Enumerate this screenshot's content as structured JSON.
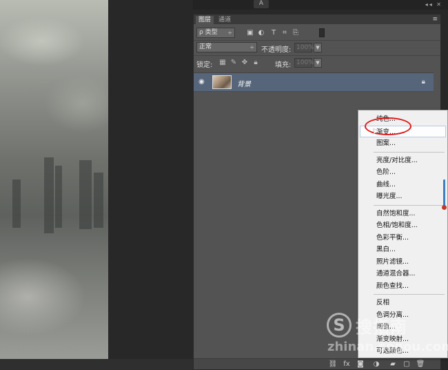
{
  "topbar": {
    "a_label": "A",
    "window_controls": "◂◂ ✕"
  },
  "panel": {
    "tabs": [
      {
        "label": "图层"
      },
      {
        "label": "通道"
      }
    ],
    "menu_icon": "≡",
    "filter": {
      "label": "ρ 类型",
      "caret": "÷"
    },
    "blend_mode": {
      "value": "正常",
      "caret": "÷"
    },
    "opacity": {
      "label": "不透明度:",
      "value": "100%"
    },
    "lock": {
      "label": "锁定:"
    },
    "fill": {
      "label": "填充:",
      "value": "100%"
    },
    "layer": {
      "name": "背景"
    }
  },
  "menu": {
    "items": [
      "纯色...",
      "渐变...",
      "图案...",
      "亮度/对比度...",
      "色阶...",
      "曲线...",
      "曝光度...",
      "自然饱和度...",
      "色相/饱和度...",
      "色彩平衡...",
      "黑白...",
      "照片滤镜...",
      "通道混合器...",
      "颜色查找...",
      "反相",
      "色调分离...",
      "阈值...",
      "渐变映射...",
      "可选颜色..."
    ],
    "highlighted": "渐变..."
  },
  "watermark": {
    "logo": "S",
    "text": "搜指南",
    "url": "zhinan.sogou.com"
  },
  "colors": {
    "layer_selected": "#56657a",
    "panel_bg": "#535353",
    "annotation": "#e01b1b"
  }
}
